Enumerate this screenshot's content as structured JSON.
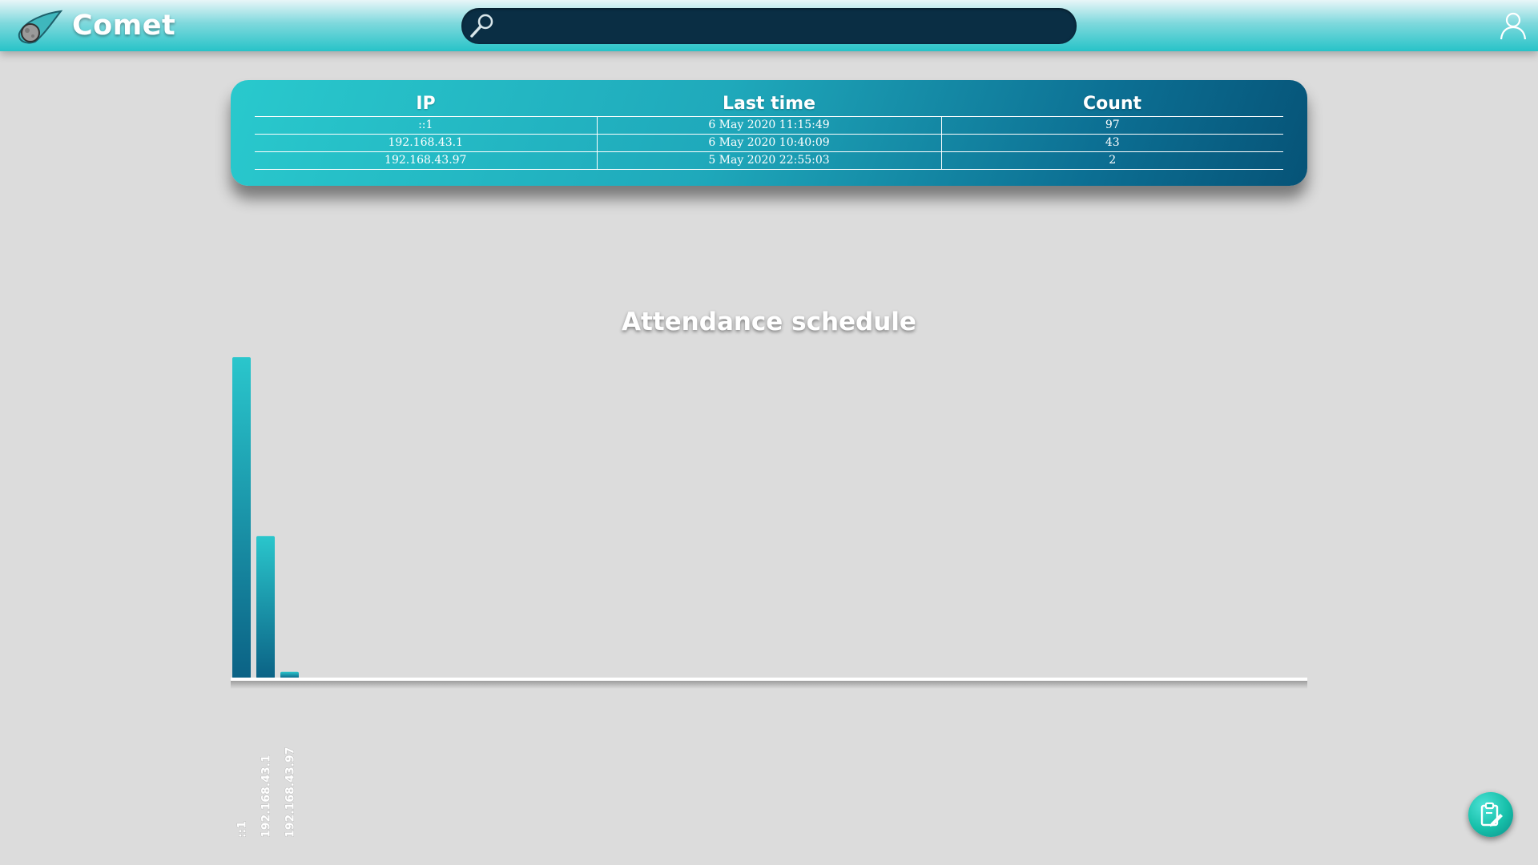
{
  "header": {
    "brand": "Comet",
    "search_value": "",
    "logo_icon": "comet-logo-icon",
    "search_icon": "magnifier-icon",
    "user_icon": "user-icon"
  },
  "table": {
    "columns": [
      "IP",
      "Last time",
      "Count"
    ],
    "rows": [
      [
        "::1",
        "6 May 2020 11:15:49",
        "97"
      ],
      [
        "192.168.43.1",
        "6 May 2020 10:40:09",
        "43"
      ],
      [
        "192.168.43.97",
        "5 May 2020 22:55:03",
        "2"
      ]
    ]
  },
  "chart_data": {
    "type": "bar",
    "title": "Attendance schedule",
    "categories": [
      "::1",
      "192.168.43.1",
      "192.168.43.97"
    ],
    "values": [
      97,
      43,
      2
    ],
    "xlabel": "",
    "ylabel": "",
    "ylim": [
      0,
      97
    ],
    "grid": false,
    "colors": {
      "bar_top": "#2ac6cc",
      "bar_bottom": "#0b6285",
      "axis": "#ffffff"
    }
  },
  "fab": {
    "icon": "clipboard-edit-icon"
  }
}
